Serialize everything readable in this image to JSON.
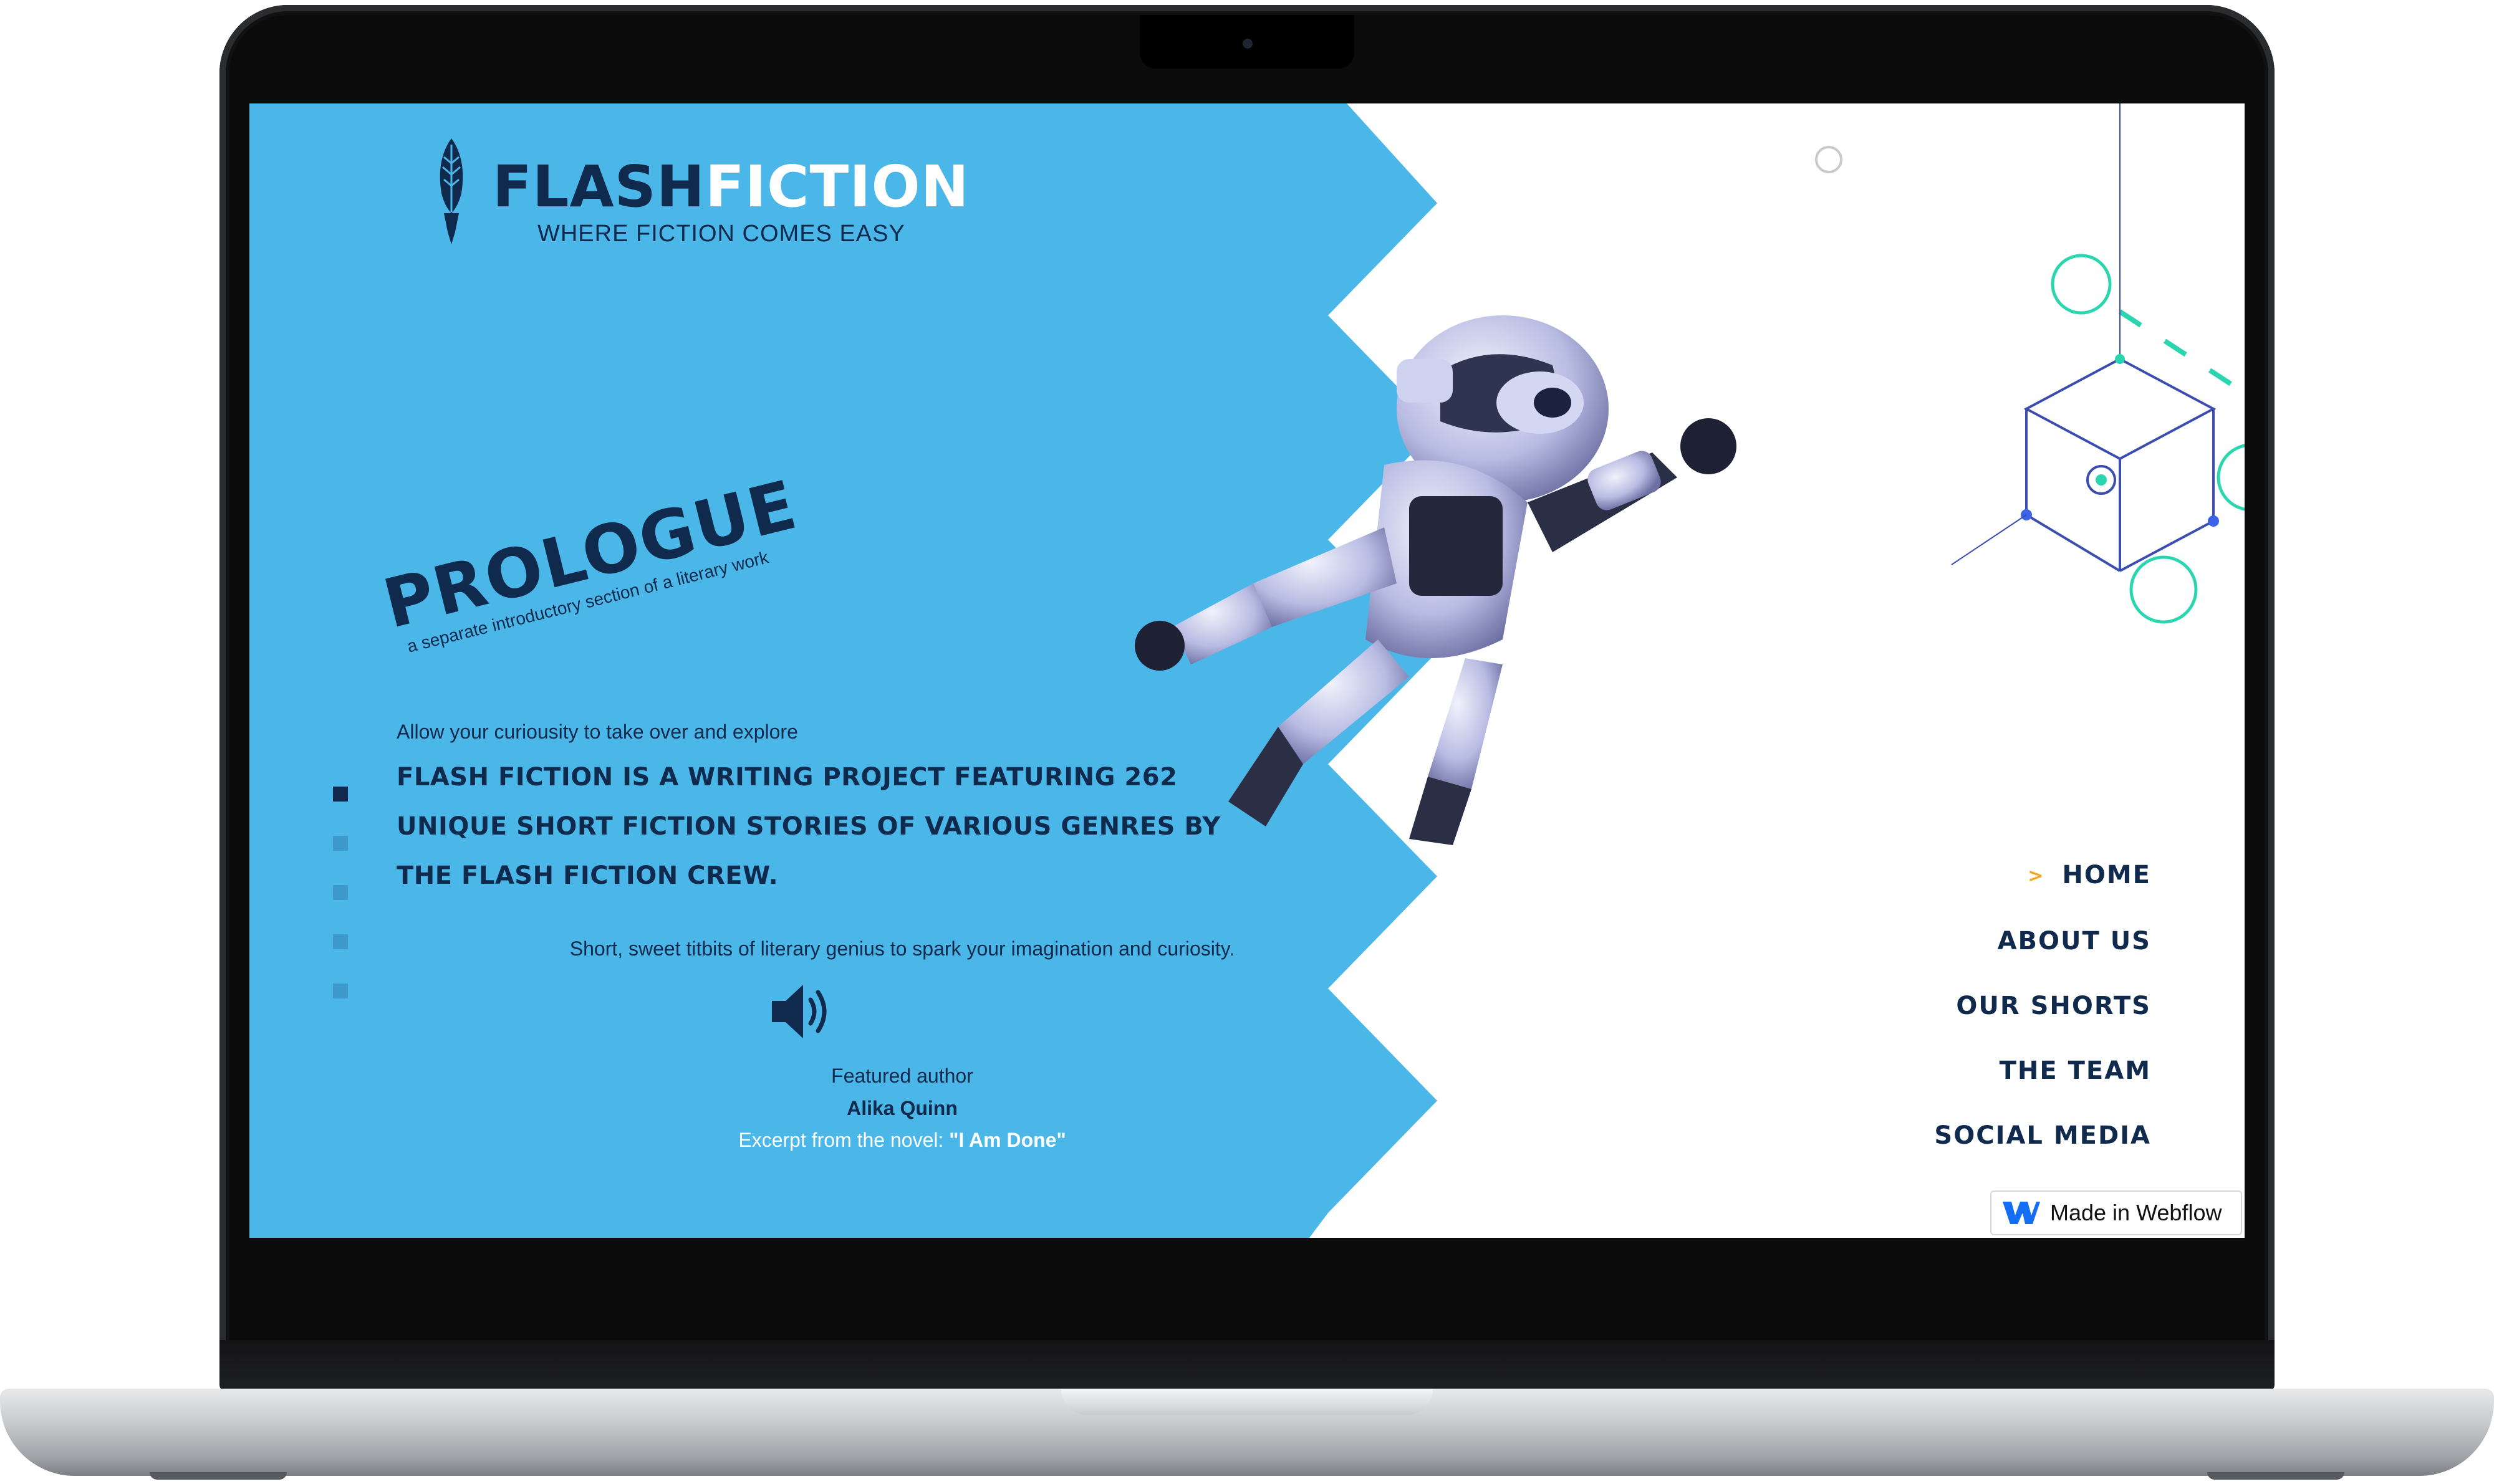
{
  "brand": {
    "name_dark": "FLASH",
    "name_light": "FICTION",
    "tagline": "WHERE FICTION COMES EASY"
  },
  "hero": {
    "heading": "PROLOGUE",
    "subheading": "a separate introductory section of a literary work",
    "intro_small": "Allow your curiousity to take over and explore",
    "intro_big": "FLASH FICTION IS A WRITING PROJECT FEATURING 262 UNIQUE SHORT FICTION STORIES OF VARIOUS GENRES BY THE FLASH FICTION CREW.",
    "tagline2": "Short, sweet titbits of literary genius to spark your imagination and curiosity.",
    "featured_label": "Featured author",
    "featured_author": "Alika Quinn",
    "excerpt_prefix": "Excerpt from the novel: ",
    "excerpt_title": "\"I Am Done\""
  },
  "slider": {
    "count": 5,
    "active_index": 0
  },
  "nav": {
    "active_marker": ">",
    "items": [
      {
        "label": "HOME",
        "active": true
      },
      {
        "label": "ABOUT US",
        "active": false
      },
      {
        "label": "OUR SHORTS",
        "active": false
      },
      {
        "label": "THE TEAM",
        "active": false
      },
      {
        "label": "SOCIAL MEDIA",
        "active": false
      }
    ]
  },
  "badge": {
    "label": "Made in Webflow"
  },
  "icons": {
    "logo": "quill-icon",
    "audio": "speaker-icon",
    "badge": "webflow-icon"
  },
  "colors": {
    "panel_blue": "#4bb7e8",
    "navy": "#0f2a4d",
    "accent_orange": "#f5a623",
    "accent_teal": "#2ad6b0",
    "accent_cube": "#3b4db0"
  }
}
